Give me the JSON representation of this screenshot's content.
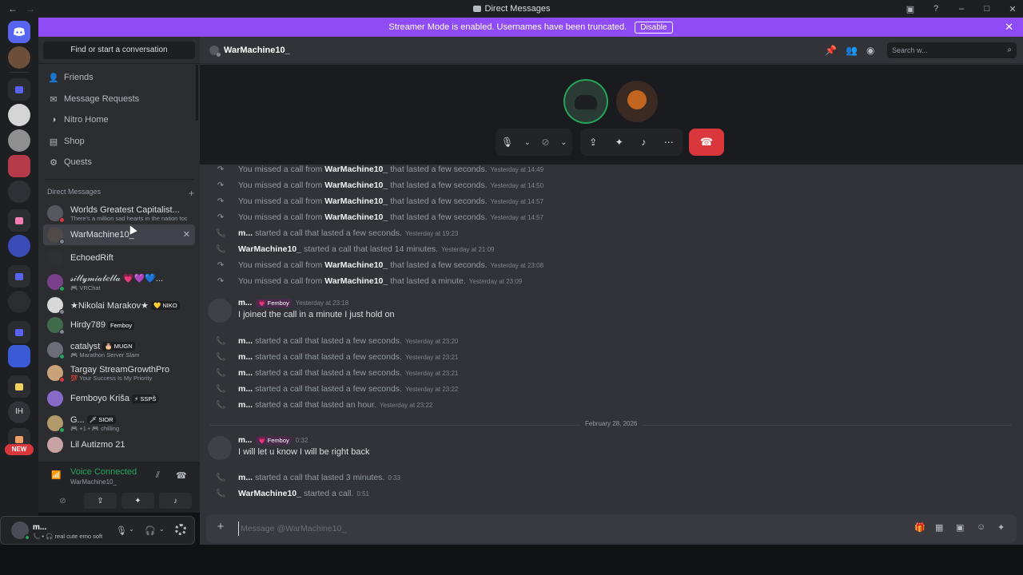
{
  "window": {
    "title": "Direct Messages",
    "back": "←",
    "forward": "→"
  },
  "banner": {
    "text": "Streamer Mode is enabled. Usernames have been truncated.",
    "disable_label": "Disable",
    "close": "✕"
  },
  "rail": {
    "new_badge": "NEW",
    "ih_label": "IH"
  },
  "sidebar": {
    "find_placeholder": "Find or start a conversation",
    "nav": [
      {
        "label": "Friends",
        "icon": "friends-icon"
      },
      {
        "label": "Message Requests",
        "icon": "envelope-icon"
      },
      {
        "label": "Nitro Home",
        "icon": "nitro-icon"
      },
      {
        "label": "Shop",
        "icon": "shop-icon"
      },
      {
        "label": "Quests",
        "icon": "quests-icon"
      }
    ],
    "dm_header": "Direct Messages",
    "dm_add": "+",
    "dms": [
      {
        "name": "Worlds Greatest Capitalist...",
        "sub": "There's a million sad hearts in the nation toc",
        "status": "#da373c",
        "avatar": "#55585f"
      },
      {
        "name": "WarMachine10_",
        "sub": "",
        "status": "#80848e",
        "avatar": "#4f4a48",
        "active": true
      },
      {
        "name": "EchoedRift",
        "sub": "",
        "status": "",
        "avatar": "#2e2f33"
      },
      {
        "name": "𝓈𝒾𝓁𝓁𝓎𝓂𝒾𝒶𝒷𝑒𝓁𝓁𝒶 💗💜💙...",
        "sub": "🎮 VRChat",
        "status": "#23a55a",
        "avatar": "#7a3f8a"
      },
      {
        "name": "★Nikolai Marakov★",
        "tag": "💛 NIKO",
        "sub": "",
        "status": "#80848e",
        "avatar": "#d8d8d8"
      },
      {
        "name": "Hirdy789",
        "tag": "Femboy",
        "sub": "",
        "status": "#80848e",
        "avatar": "#3f6b4a"
      },
      {
        "name": "catalyst",
        "tag": "🎂 MUGN",
        "sub": "🎮 Marathon Server Slam",
        "status": "#23a55a",
        "avatar": "#6b6e76"
      },
      {
        "name": "Targay StreamGrowthPro",
        "sub": "💯 Your Success Is My Priority",
        "status": "#da373c",
        "avatar": "#c9a27a"
      },
      {
        "name": "Femboyo Kriša",
        "tag": "⚡ SSPŠ",
        "sub": "",
        "status": "",
        "avatar": "#8a6ac9"
      },
      {
        "name": "G...",
        "tag": "🗡 SIOR",
        "sub": "🎮 +1 • 🎮 chilling",
        "status": "#23a55a",
        "avatar": "#b39a6a"
      },
      {
        "name": "Lil Autizmo 21",
        "sub": "",
        "status": "",
        "avatar": "#c9a3a3"
      }
    ]
  },
  "voice": {
    "status": "Voice Connected",
    "channel": "WarMachine10_"
  },
  "user": {
    "name": "m...",
    "status": "📞 • 🎧 real cute emo soft"
  },
  "header": {
    "name": "WarMachine10_",
    "search_placeholder": "Search w..."
  },
  "messages": {
    "calls_top": [
      {
        "type": "missed",
        "prefix": "You missed a call from",
        "name": "WarMachine10_",
        "suffix": "that lasted a few seconds.",
        "ts": "Yesterday at 14:49"
      },
      {
        "type": "missed",
        "prefix": "You missed a call from",
        "name": "WarMachine10_",
        "suffix": "that lasted a few seconds.",
        "ts": "Yesterday at 14:50"
      },
      {
        "type": "missed",
        "prefix": "You missed a call from",
        "name": "WarMachine10_",
        "suffix": "that lasted a few seconds.",
        "ts": "Yesterday at 14:57"
      },
      {
        "type": "missed",
        "prefix": "You missed a call from",
        "name": "WarMachine10_",
        "suffix": "that lasted a few seconds.",
        "ts": "Yesterday at 14:57"
      },
      {
        "type": "ok",
        "prefix": "",
        "name": "m...",
        "suffix": "started a call that lasted a few seconds.",
        "ts": "Yesterday at 19:23"
      },
      {
        "type": "ok",
        "prefix": "",
        "name": "WarMachine10_",
        "suffix": "started a call that lasted 14 minutes.",
        "ts": "Yesterday at 21:09"
      },
      {
        "type": "missed",
        "prefix": "You missed a call from",
        "name": "WarMachine10_",
        "suffix": "that lasted a few seconds.",
        "ts": "Yesterday at 23:08"
      },
      {
        "type": "missed",
        "prefix": "You missed a call from",
        "name": "WarMachine10_",
        "suffix": "that lasted a minute.",
        "ts": "Yesterday at 23:09"
      }
    ],
    "msg1": {
      "author": "m...",
      "tag": "💗 Femboy",
      "ts": "Yesterday at 23:18",
      "text": "I joined the call in a minute I just hold on"
    },
    "calls_mid": [
      {
        "type": "ok",
        "prefix": "",
        "name": "m...",
        "suffix": "started a call that lasted a few seconds.",
        "ts": "Yesterday at 23:20"
      },
      {
        "type": "ok",
        "prefix": "",
        "name": "m...",
        "suffix": "started a call that lasted a few seconds.",
        "ts": "Yesterday at 23:21"
      },
      {
        "type": "ok",
        "prefix": "",
        "name": "m...",
        "suffix": "started a call that lasted a few seconds.",
        "ts": "Yesterday at 23:21"
      },
      {
        "type": "ok",
        "prefix": "",
        "name": "m...",
        "suffix": "started a call that lasted a few seconds.",
        "ts": "Yesterday at 23:22"
      },
      {
        "type": "ok",
        "prefix": "",
        "name": "m...",
        "suffix": "started a call that lasted an hour.",
        "ts": "Yesterday at 23:22"
      }
    ],
    "date_divider": "February 28, 2026",
    "msg2": {
      "author": "m...",
      "tag": "💗 Femboy",
      "ts": "0:32",
      "text": "I will let u know I will be right back"
    },
    "calls_bottom": [
      {
        "type": "ok",
        "prefix": "",
        "name": "m...",
        "suffix": "started a call that lasted 3 minutes.",
        "ts": "0:33"
      },
      {
        "type": "ok",
        "prefix": "",
        "name": "WarMachine10_",
        "suffix": "started a call.",
        "ts": "0:51"
      }
    ]
  },
  "composer": {
    "placeholder": "Message @WarMachine10_"
  }
}
